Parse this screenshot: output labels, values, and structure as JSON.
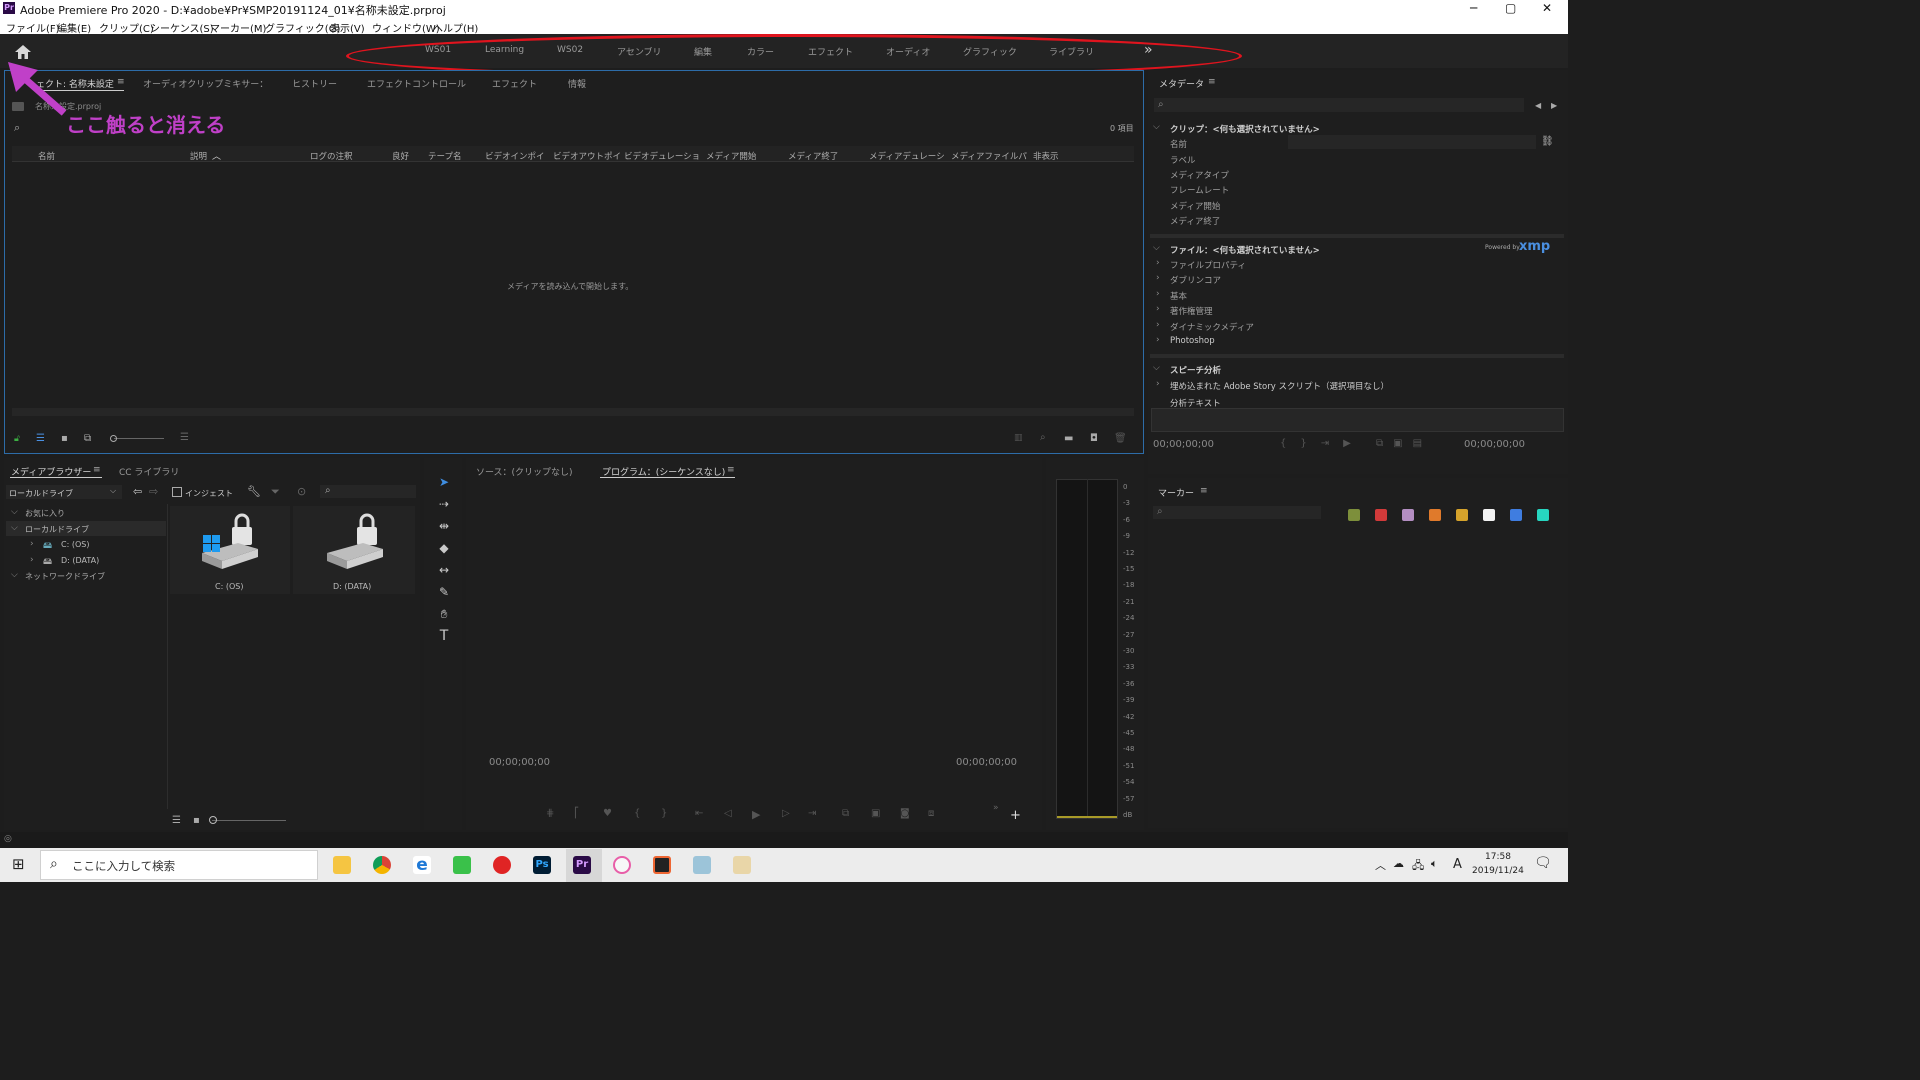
{
  "window": {
    "title": "Adobe Premiere Pro 2020 - D:¥adobe¥Pr¥SMP20191124_01¥名称未設定.prproj",
    "logo": "Pr",
    "minimize": "─",
    "maximize": "▢",
    "close": "✕"
  },
  "menu": [
    "ファイル(F)",
    "編集(E)",
    "クリップ(C)",
    "シーケンス(S)",
    "マーカー(M)",
    "グラフィック(G)",
    "表示(V)",
    "ウィンドウ(W)",
    "ヘルプ(H)"
  ],
  "workspaces": [
    "WS01",
    "Learning",
    "WS02",
    "アセンブリ",
    "編集",
    "カラー",
    "エフェクト",
    "オーディオ",
    "グラフィック",
    "ライブラリ"
  ],
  "workspaces_more": "»",
  "annotation": {
    "text": "ここ触ると消える",
    "color": "#c040c8",
    "ellipse_color": "#e0141e"
  },
  "project_panel": {
    "tabs": [
      "ェクト: 名称未設定",
      "オーディオクリップミキサー：",
      "ヒストリー",
      "エフェクトコントロール",
      "エフェクト",
      "情報"
    ],
    "file": "名称未設定.prproj",
    "item_count": "0 項目",
    "columns": [
      "名前",
      "説明",
      "ログの注釈",
      "良好",
      "テープ名",
      "ビデオインポイ",
      "ビデオアウトポイ",
      "ビデオデュレーショ",
      "メディア開始",
      "メディア終了",
      "メディアデュレーシ",
      "メディアファイルパ",
      "非表示"
    ],
    "empty_message": "メディアを読み込んで開始します。"
  },
  "metadata_panel": {
    "title": "メタデータ",
    "clip_section": "クリップ：<何も選択されていません>",
    "clip_fields": [
      "名前",
      "ラベル",
      "メディアタイプ",
      "フレームレート",
      "メディア開始",
      "メディア終了"
    ],
    "file_section": "ファイル：<何も選択されていません>",
    "xmp_powered": "Powered by",
    "xmp_logo": "xmp",
    "file_groups": [
      "ファイルプロパティ",
      "ダブリンコア",
      "基本",
      "著作権管理",
      "ダイナミックメディア",
      "Photoshop"
    ],
    "speech_section": "スピーチ分析",
    "speech_items": [
      "埋め込まれた Adobe Story スクリプト（選択項目なし）",
      "分析テキスト"
    ],
    "timecode_left": "00;00;00;00",
    "timecode_right": "00;00;00;00"
  },
  "marker_panel": {
    "title": "マーカー",
    "swatches": [
      "#7d8f3b",
      "#d23a3a",
      "#b48ec2",
      "#e07a2b",
      "#d6a32b",
      "#f2f2f2",
      "#3f7de0",
      "#27d6c0"
    ]
  },
  "media_browser": {
    "tabs": [
      "メディアブラウザー",
      "CC ライブラリ"
    ],
    "location": "ローカルドライブ",
    "ingest": "インジェスト",
    "tree": [
      "お気に入り",
      "ローカルドライブ",
      "C: (OS)",
      "D: (DATA)",
      "ネットワークドライブ"
    ],
    "drives": [
      "C: (OS)",
      "D: (DATA)"
    ]
  },
  "monitor": {
    "source_tab": "ソース：(クリップなし)",
    "program_tab": "プログラム：(シーケンスなし)",
    "timecode_left": "00;00;00;00",
    "timecode_right": "00;00;00;00"
  },
  "audio_meter": {
    "scale": [
      "0",
      "-3",
      "-6",
      "-9",
      "-12",
      "-15",
      "-18",
      "-21",
      "-24",
      "-27",
      "-30",
      "-33",
      "-36",
      "-39",
      "-42",
      "-45",
      "-48",
      "-51",
      "-54",
      "-57",
      "dB"
    ]
  },
  "taskbar": {
    "search_placeholder": "ここに入力して検索",
    "time": "17:58",
    "date": "2019/11/24",
    "ime": "A"
  }
}
